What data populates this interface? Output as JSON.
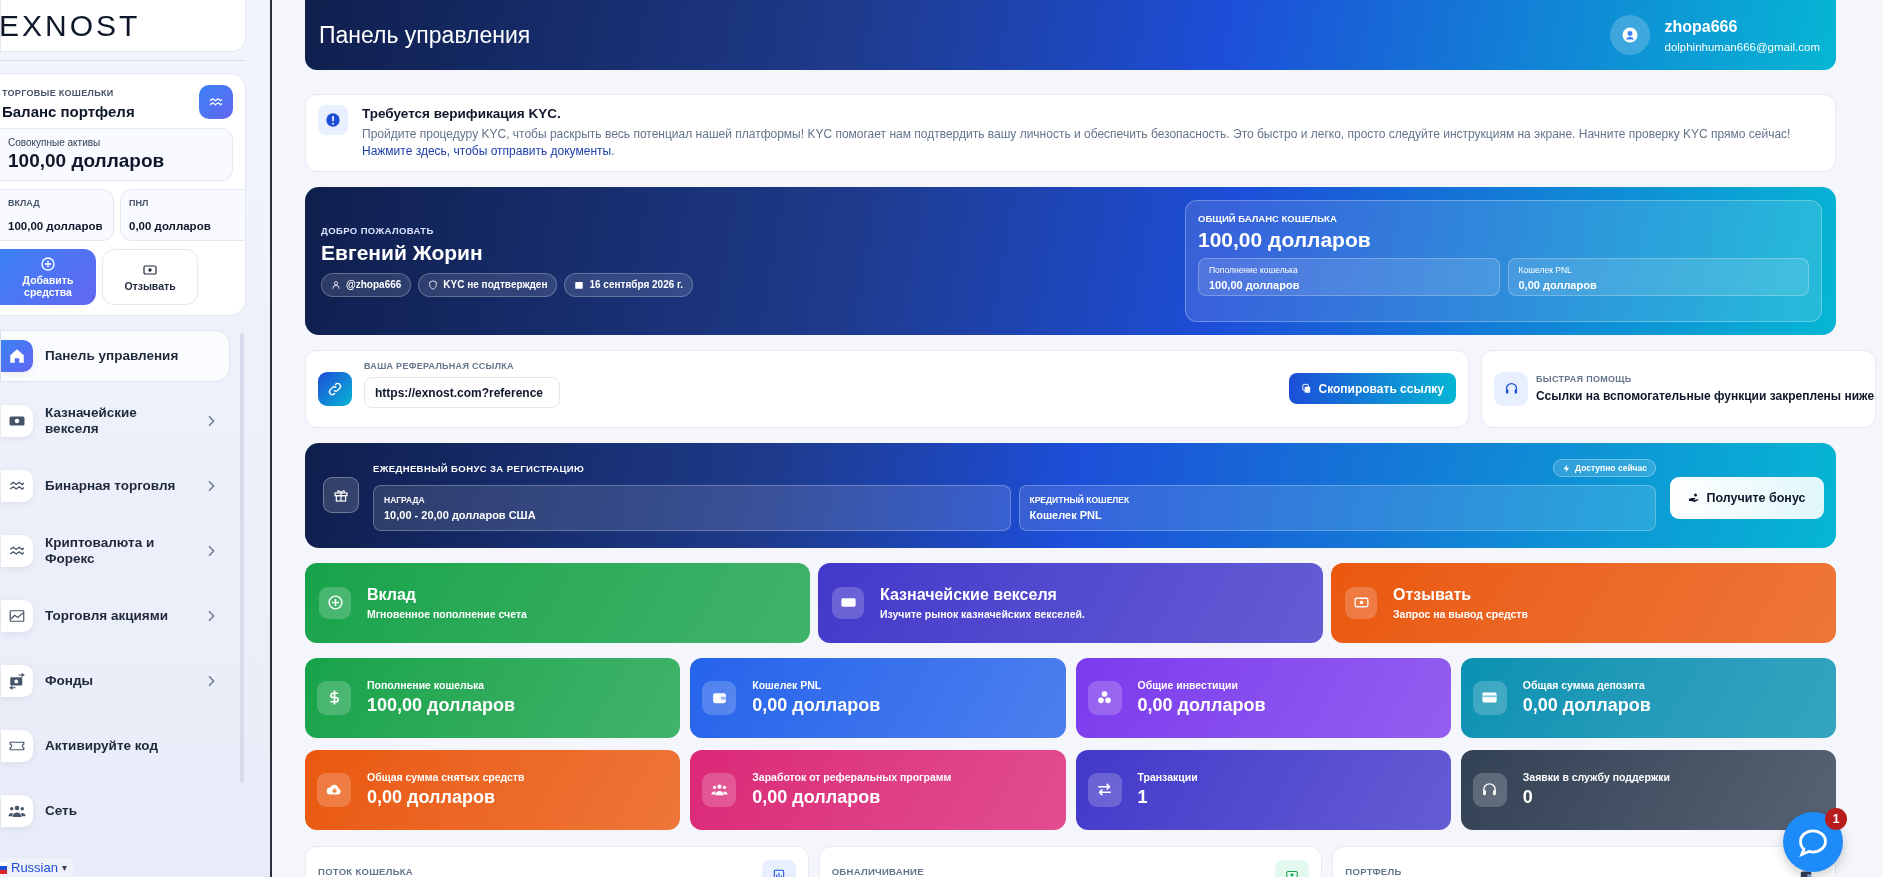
{
  "sidebar": {
    "logo": "EXNOST",
    "wallet": {
      "label": "ТОРГОВЫЕ КОШЕЛЬКИ",
      "title": "Баланс портфеля",
      "total_label": "Совокупные активы",
      "total": "100,00 долларов",
      "stats": [
        {
          "label": "ВКЛАД",
          "value": "100,00 долларов"
        },
        {
          "label": "ПНЛ",
          "value": "0,00 долларов"
        }
      ],
      "buttons": [
        {
          "label": "Добавить средства",
          "kind": "primary"
        },
        {
          "label": "Отзывать",
          "kind": "secondary"
        }
      ]
    },
    "nav": [
      {
        "label": "Панель управления",
        "selected": true,
        "expandable": false
      },
      {
        "label": "Казначейские векселя",
        "selected": false,
        "expandable": true
      },
      {
        "label": "Бинарная торговля",
        "selected": false,
        "expandable": true
      },
      {
        "label": "Криптовалюта и Форекс",
        "selected": false,
        "expandable": true
      },
      {
        "label": "Торговля акциями",
        "selected": false,
        "expandable": true
      },
      {
        "label": "Фонды",
        "selected": false,
        "expandable": true
      },
      {
        "label": "Активируйте код",
        "selected": false,
        "expandable": false
      },
      {
        "label": "Сеть",
        "selected": false,
        "expandable": false
      }
    ],
    "language": {
      "value": "Russian",
      "caret": "▾"
    }
  },
  "header": {
    "title": "Панель управления",
    "user": {
      "name": "zhopa666",
      "email": "dolphinhuman666@gmail.com"
    }
  },
  "kyc": {
    "title": "Требуется верификация KYC.",
    "text": "Пройдите процедуру KYC, чтобы раскрыть весь потенциал нашей платформы! KYC помогает нам подтвердить вашу личность и обеспечить безопасность. Это быстро и легко, просто следуйте инструкциям на экране. Начните проверку KYC прямо сейчас! ",
    "link": "Нажмите здесь, чтобы отправить документы",
    "text_end": "."
  },
  "welcome": {
    "label": "ДОБРО ПОЖАЛОВАТЬ",
    "name": "Евгений Жорин",
    "chips": [
      "@zhopa666",
      "KYC не подтвержден",
      "16 сентября 2026 г."
    ],
    "balance": {
      "label": "ОБЩИЙ БАЛАНС КОШЕЛЬКА",
      "value": "100,00 долларов",
      "items": [
        {
          "label": "Пополнение кошелька",
          "value": "100,00 долларов"
        },
        {
          "label": "Кошелек PNL",
          "value": "0,00 долларов"
        }
      ]
    }
  },
  "referral": {
    "label": "ВАША РЕФЕРАЛЬНАЯ ССЫЛКА",
    "value": "https://exnost.com?reference",
    "button": "Скопировать ссылку"
  },
  "help": {
    "label": "БЫСТРАЯ ПОМОЩЬ",
    "text": "Ссылки на вспомогательные функции закреплены ниже"
  },
  "bonus": {
    "label": "ЕЖЕДНЕВНЫЙ БОНУС ЗА РЕГИСТРАЦИЮ",
    "badge": "Доступно сейчас",
    "items": [
      {
        "label": "НАГРАДА",
        "value": "10,00 - 20,00 долларов США"
      },
      {
        "label": "КРЕДИТНЫЙ КОШЕЛЕК",
        "value": "Кошелек PNL"
      }
    ],
    "button": "Получите бонус"
  },
  "actions": [
    {
      "title": "Вклад",
      "subtitle": "Мгновенное пополнение счета",
      "color": "#16a34a"
    },
    {
      "title": "Казначейские векселя",
      "subtitle": "Изучите рынок казначейских векселей.",
      "color": "#4338ca"
    },
    {
      "title": "Отзывать",
      "subtitle": "Запрос на вывод средств",
      "color": "#ea580c"
    }
  ],
  "stats": [
    {
      "label": "Пополнение кошелька",
      "value": "100,00 долларов",
      "color": "#16a34a"
    },
    {
      "label": "Кошелек PNL",
      "value": "0,00 долларов",
      "color": "#2563eb"
    },
    {
      "label": "Общие инвестиции",
      "value": "0,00 долларов",
      "color": "#7c3aed"
    },
    {
      "label": "Общая сумма депозита",
      "value": "0,00 долларов",
      "color": "#0891b2"
    },
    {
      "label": "Общая сумма снятых средств",
      "value": "0,00 долларов",
      "color": "#ea580c"
    },
    {
      "label": "Заработок от реферальных программ",
      "value": "0,00 долларов",
      "color": "#db2777"
    },
    {
      "label": "Транзакции",
      "value": "1",
      "color": "#4338ca"
    },
    {
      "label": "Заявки в службу поддержки",
      "value": "0",
      "color": "#334155"
    }
  ],
  "panels": [
    "ПОТОК КОШЕЛЬКА",
    "ОБНАЛИЧИВАНИЕ",
    "ПОРТФЕЛЬ"
  ],
  "chat": {
    "badge": "1"
  }
}
